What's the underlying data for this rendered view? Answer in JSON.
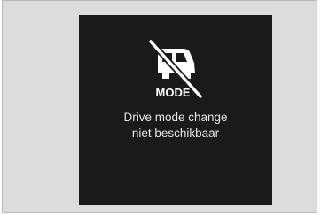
{
  "display": {
    "icon_label": "MODE",
    "message_line1": "Drive mode change",
    "message_line2": "niet beschikbaar"
  },
  "colors": {
    "screen_background": "#1a1a1a",
    "frame_background": "#dcdcdc",
    "icon_color": "#ffffff",
    "text_color": "#e6e6e6"
  },
  "icons": {
    "mode_unavailable": "mode-disabled-icon"
  }
}
